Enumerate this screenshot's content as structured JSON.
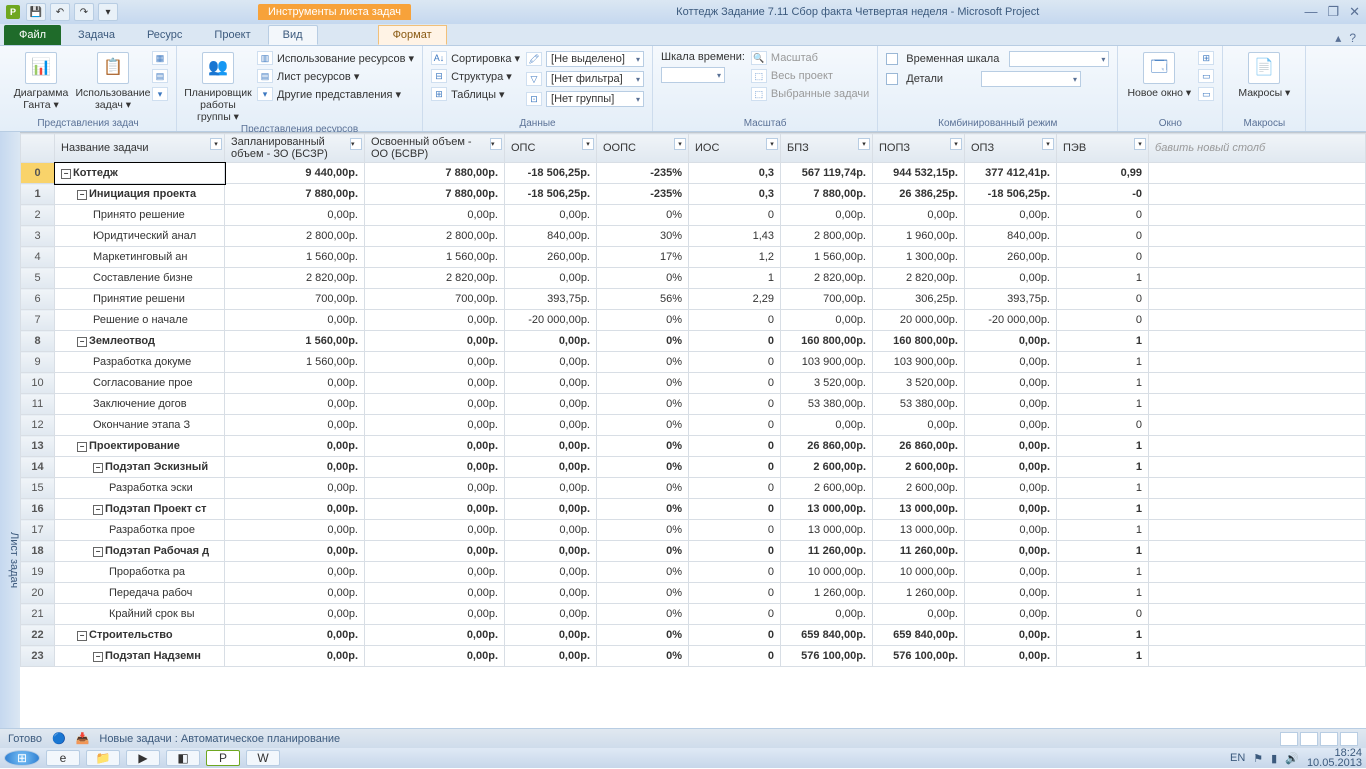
{
  "window": {
    "title": "Коттедж Задание 7.11  Сбор факта Четвертая неделя  -  Microsoft Project",
    "context_tab": "Инструменты листа задач",
    "minimize": "—",
    "maximize": "❐",
    "close": "✕"
  },
  "qat": {
    "save": "💾",
    "undo": "↶",
    "redo": "↷",
    "more": "▾"
  },
  "tabs": {
    "file": "Файл",
    "task": "Задача",
    "resource": "Ресурс",
    "project": "Проект",
    "view": "Вид",
    "format": "Формат"
  },
  "help": {
    "min_ribbon": "▴",
    "help": "?"
  },
  "ribbon": {
    "g1": {
      "label": "Представления задач",
      "gantt": "Диаграмма Ганта ▾",
      "usage": "Использование задач ▾"
    },
    "g2": {
      "label": "Представления ресурсов",
      "planner": "Планировщик работы группы ▾",
      "a": "Использование ресурсов ▾",
      "b": "Лист ресурсов ▾",
      "c": "Другие представления ▾"
    },
    "g3": {
      "label": "Данные",
      "sort": "Сортировка ▾",
      "outline": "Структура ▾",
      "tables": "Таблицы ▾",
      "f1": "[Не выделено]",
      "f2": "[Нет фильтра]",
      "f3": "[Нет группы]"
    },
    "g4": {
      "label": "Масштаб",
      "scale": "Шкала времени:",
      "zoom": "Масштаб",
      "whole": "Весь проект",
      "sel": "Выбранные задачи"
    },
    "g5": {
      "label": "Комбинированный режим",
      "a": "Временная шкала",
      "b": "Детали"
    },
    "g6": {
      "label": "Окно",
      "new": "Новое окно ▾"
    },
    "g7": {
      "label": "Макросы",
      "macros": "Макросы ▾"
    }
  },
  "sidebar": "Лист задач",
  "columns": {
    "name": "Название задачи",
    "c1a": "Запланированный",
    "c1b": "объем - ЗО (БСЗР)",
    "c2a": "Освоенный объем -",
    "c2b": "ОО (БСВР)",
    "c3": "ОПС",
    "c4": "ООПС",
    "c5": "ИОС",
    "c6": "БПЗ",
    "c7": "ПОПЗ",
    "c8": "ОПЗ",
    "c9": "ПЭВ",
    "add": "бавить новый столб"
  },
  "rows": [
    {
      "n": "0",
      "lvl": 0,
      "sum": true,
      "name": "Коттедж",
      "c1": "9 440,00р.",
      "c2": "7 880,00р.",
      "c3": "-18 506,25р.",
      "c4": "-235%",
      "c5": "0,3",
      "c6": "567 119,74р.",
      "c7": "944 532,15р.",
      "c8": "377 412,41р.",
      "c9": "0,99"
    },
    {
      "n": "1",
      "lvl": 1,
      "sum": true,
      "name": "Инициация проекта",
      "c1": "7 880,00р.",
      "c2": "7 880,00р.",
      "c3": "-18 506,25р.",
      "c4": "-235%",
      "c5": "0,3",
      "c6": "7 880,00р.",
      "c7": "26 386,25р.",
      "c8": "-18 506,25р.",
      "c9": "-0"
    },
    {
      "n": "2",
      "lvl": 2,
      "sum": false,
      "name": "Принято решение",
      "c1": "0,00р.",
      "c2": "0,00р.",
      "c3": "0,00р.",
      "c4": "0%",
      "c5": "0",
      "c6": "0,00р.",
      "c7": "0,00р.",
      "c8": "0,00р.",
      "c9": "0"
    },
    {
      "n": "3",
      "lvl": 2,
      "sum": false,
      "name": "Юридтический анал",
      "c1": "2 800,00р.",
      "c2": "2 800,00р.",
      "c3": "840,00р.",
      "c4": "30%",
      "c5": "1,43",
      "c6": "2 800,00р.",
      "c7": "1 960,00р.",
      "c8": "840,00р.",
      "c9": "0"
    },
    {
      "n": "4",
      "lvl": 2,
      "sum": false,
      "name": "Маркетинговый ан",
      "c1": "1 560,00р.",
      "c2": "1 560,00р.",
      "c3": "260,00р.",
      "c4": "17%",
      "c5": "1,2",
      "c6": "1 560,00р.",
      "c7": "1 300,00р.",
      "c8": "260,00р.",
      "c9": "0"
    },
    {
      "n": "5",
      "lvl": 2,
      "sum": false,
      "name": "Составление бизне",
      "c1": "2 820,00р.",
      "c2": "2 820,00р.",
      "c3": "0,00р.",
      "c4": "0%",
      "c5": "1",
      "c6": "2 820,00р.",
      "c7": "2 820,00р.",
      "c8": "0,00р.",
      "c9": "1"
    },
    {
      "n": "6",
      "lvl": 2,
      "sum": false,
      "name": "Принятие решени",
      "c1": "700,00р.",
      "c2": "700,00р.",
      "c3": "393,75р.",
      "c4": "56%",
      "c5": "2,29",
      "c6": "700,00р.",
      "c7": "306,25р.",
      "c8": "393,75р.",
      "c9": "0"
    },
    {
      "n": "7",
      "lvl": 2,
      "sum": false,
      "name": "Решение о начале",
      "c1": "0,00р.",
      "c2": "0,00р.",
      "c3": "-20 000,00р.",
      "c4": "0%",
      "c5": "0",
      "c6": "0,00р.",
      "c7": "20 000,00р.",
      "c8": "-20 000,00р.",
      "c9": "0"
    },
    {
      "n": "8",
      "lvl": 1,
      "sum": true,
      "name": "Землеотвод",
      "c1": "1 560,00р.",
      "c2": "0,00р.",
      "c3": "0,00р.",
      "c4": "0%",
      "c5": "0",
      "c6": "160 800,00р.",
      "c7": "160 800,00р.",
      "c8": "0,00р.",
      "c9": "1"
    },
    {
      "n": "9",
      "lvl": 2,
      "sum": false,
      "name": "Разработка докуме",
      "c1": "1 560,00р.",
      "c2": "0,00р.",
      "c3": "0,00р.",
      "c4": "0%",
      "c5": "0",
      "c6": "103 900,00р.",
      "c7": "103 900,00р.",
      "c8": "0,00р.",
      "c9": "1"
    },
    {
      "n": "10",
      "lvl": 2,
      "sum": false,
      "name": "Согласование прое",
      "c1": "0,00р.",
      "c2": "0,00р.",
      "c3": "0,00р.",
      "c4": "0%",
      "c5": "0",
      "c6": "3 520,00р.",
      "c7": "3 520,00р.",
      "c8": "0,00р.",
      "c9": "1"
    },
    {
      "n": "11",
      "lvl": 2,
      "sum": false,
      "name": "Заключение догов",
      "c1": "0,00р.",
      "c2": "0,00р.",
      "c3": "0,00р.",
      "c4": "0%",
      "c5": "0",
      "c6": "53 380,00р.",
      "c7": "53 380,00р.",
      "c8": "0,00р.",
      "c9": "1"
    },
    {
      "n": "12",
      "lvl": 2,
      "sum": false,
      "name": "Окончание этапа З",
      "c1": "0,00р.",
      "c2": "0,00р.",
      "c3": "0,00р.",
      "c4": "0%",
      "c5": "0",
      "c6": "0,00р.",
      "c7": "0,00р.",
      "c8": "0,00р.",
      "c9": "0"
    },
    {
      "n": "13",
      "lvl": 1,
      "sum": true,
      "name": "Проектирование",
      "c1": "0,00р.",
      "c2": "0,00р.",
      "c3": "0,00р.",
      "c4": "0%",
      "c5": "0",
      "c6": "26 860,00р.",
      "c7": "26 860,00р.",
      "c8": "0,00р.",
      "c9": "1"
    },
    {
      "n": "14",
      "lvl": 2,
      "sum": true,
      "name": "Подэтап Эскизный",
      "c1": "0,00р.",
      "c2": "0,00р.",
      "c3": "0,00р.",
      "c4": "0%",
      "c5": "0",
      "c6": "2 600,00р.",
      "c7": "2 600,00р.",
      "c8": "0,00р.",
      "c9": "1"
    },
    {
      "n": "15",
      "lvl": 3,
      "sum": false,
      "name": "Разработка эски",
      "c1": "0,00р.",
      "c2": "0,00р.",
      "c3": "0,00р.",
      "c4": "0%",
      "c5": "0",
      "c6": "2 600,00р.",
      "c7": "2 600,00р.",
      "c8": "0,00р.",
      "c9": "1"
    },
    {
      "n": "16",
      "lvl": 2,
      "sum": true,
      "name": "Подэтап Проект ст",
      "c1": "0,00р.",
      "c2": "0,00р.",
      "c3": "0,00р.",
      "c4": "0%",
      "c5": "0",
      "c6": "13 000,00р.",
      "c7": "13 000,00р.",
      "c8": "0,00р.",
      "c9": "1"
    },
    {
      "n": "17",
      "lvl": 3,
      "sum": false,
      "name": "Разработка прое",
      "c1": "0,00р.",
      "c2": "0,00р.",
      "c3": "0,00р.",
      "c4": "0%",
      "c5": "0",
      "c6": "13 000,00р.",
      "c7": "13 000,00р.",
      "c8": "0,00р.",
      "c9": "1"
    },
    {
      "n": "18",
      "lvl": 2,
      "sum": true,
      "name": "Подэтап Рабочая д",
      "c1": "0,00р.",
      "c2": "0,00р.",
      "c3": "0,00р.",
      "c4": "0%",
      "c5": "0",
      "c6": "11 260,00р.",
      "c7": "11 260,00р.",
      "c8": "0,00р.",
      "c9": "1"
    },
    {
      "n": "19",
      "lvl": 3,
      "sum": false,
      "name": "Проработка ра",
      "c1": "0,00р.",
      "c2": "0,00р.",
      "c3": "0,00р.",
      "c4": "0%",
      "c5": "0",
      "c6": "10 000,00р.",
      "c7": "10 000,00р.",
      "c8": "0,00р.",
      "c9": "1"
    },
    {
      "n": "20",
      "lvl": 3,
      "sum": false,
      "name": "Передача рабоч",
      "c1": "0,00р.",
      "c2": "0,00р.",
      "c3": "0,00р.",
      "c4": "0%",
      "c5": "0",
      "c6": "1 260,00р.",
      "c7": "1 260,00р.",
      "c8": "0,00р.",
      "c9": "1"
    },
    {
      "n": "21",
      "lvl": 3,
      "sum": false,
      "name": "Крайний срок вы",
      "c1": "0,00р.",
      "c2": "0,00р.",
      "c3": "0,00р.",
      "c4": "0%",
      "c5": "0",
      "c6": "0,00р.",
      "c7": "0,00р.",
      "c8": "0,00р.",
      "c9": "0"
    },
    {
      "n": "22",
      "lvl": 1,
      "sum": true,
      "name": "Строительство",
      "c1": "0,00р.",
      "c2": "0,00р.",
      "c3": "0,00р.",
      "c4": "0%",
      "c5": "0",
      "c6": "659 840,00р.",
      "c7": "659 840,00р.",
      "c8": "0,00р.",
      "c9": "1"
    },
    {
      "n": "23",
      "lvl": 2,
      "sum": true,
      "name": "Подэтап Надземн",
      "c1": "0,00р.",
      "c2": "0,00р.",
      "c3": "0,00р.",
      "c4": "0%",
      "c5": "0",
      "c6": "576 100,00р.",
      "c7": "576 100,00р.",
      "c8": "0,00р.",
      "c9": "1"
    }
  ],
  "status": {
    "ready": "Готово",
    "mode": "Новые задачи : Автоматическое планирование"
  },
  "tray": {
    "lang": "EN",
    "time": "18:24",
    "date": "10.05.2013"
  }
}
